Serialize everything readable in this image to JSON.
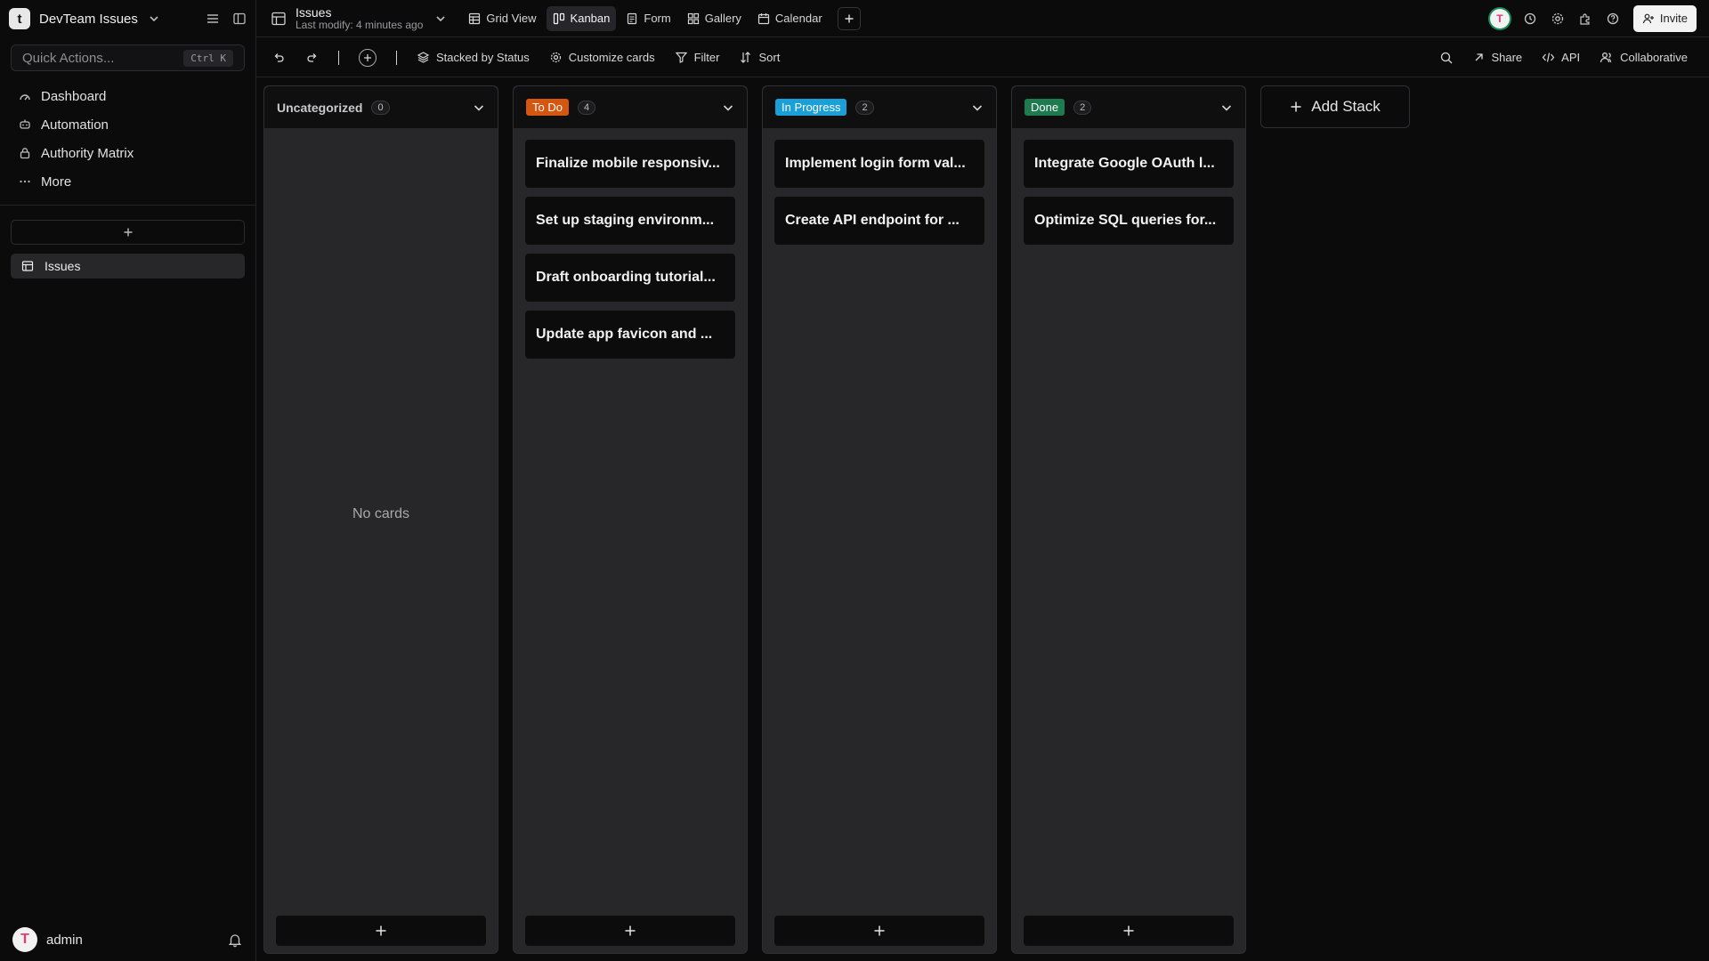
{
  "workspace": {
    "name": "DevTeam Issues",
    "logo_letter": "t"
  },
  "quick_actions": {
    "label": "Quick Actions...",
    "shortcut": "Ctrl K"
  },
  "nav": [
    {
      "label": "Dashboard",
      "icon": "dashboard-icon"
    },
    {
      "label": "Automation",
      "icon": "automation-icon"
    },
    {
      "label": "Authority Matrix",
      "icon": "lock-icon"
    },
    {
      "label": "More",
      "icon": "more-icon"
    }
  ],
  "tables": [
    {
      "label": "Issues",
      "icon": "table-icon"
    }
  ],
  "user": {
    "name": "admin",
    "avatar_letter": "T"
  },
  "header": {
    "table_name": "Issues",
    "last_modified": "Last modify: 4 minutes ago",
    "views": [
      {
        "label": "Grid View",
        "icon": "grid-icon",
        "active": false
      },
      {
        "label": "Kanban",
        "icon": "kanban-icon",
        "active": true
      },
      {
        "label": "Form",
        "icon": "form-icon",
        "active": false
      },
      {
        "label": "Gallery",
        "icon": "gallery-icon",
        "active": false
      },
      {
        "label": "Calendar",
        "icon": "calendar-icon",
        "active": false
      }
    ],
    "invite_label": "Invite",
    "avatar_letter": "T"
  },
  "toolbar": {
    "stacked_by": "Stacked by Status",
    "customize": "Customize cards",
    "filter": "Filter",
    "sort": "Sort",
    "share": "Share",
    "api": "API",
    "collaborative": "Collaborative"
  },
  "board": {
    "empty_text": "No cards",
    "add_stack_label": "Add Stack",
    "stacks": [
      {
        "name": "Uncategorized",
        "count": "0",
        "color": "",
        "cards": []
      },
      {
        "name": "To Do",
        "count": "4",
        "color": "#d4560f",
        "cards": [
          "Finalize mobile responsiv...",
          "Set up staging environm...",
          "Draft onboarding tutorial...",
          "Update app favicon and ..."
        ]
      },
      {
        "name": "In Progress",
        "count": "2",
        "color": "#1a9fd6",
        "cards": [
          "Implement login form val...",
          "Create API endpoint for ..."
        ]
      },
      {
        "name": "Done",
        "count": "2",
        "color": "#1e7a4f",
        "cards": [
          "Integrate Google OAuth l...",
          "Optimize SQL queries for..."
        ]
      }
    ]
  }
}
